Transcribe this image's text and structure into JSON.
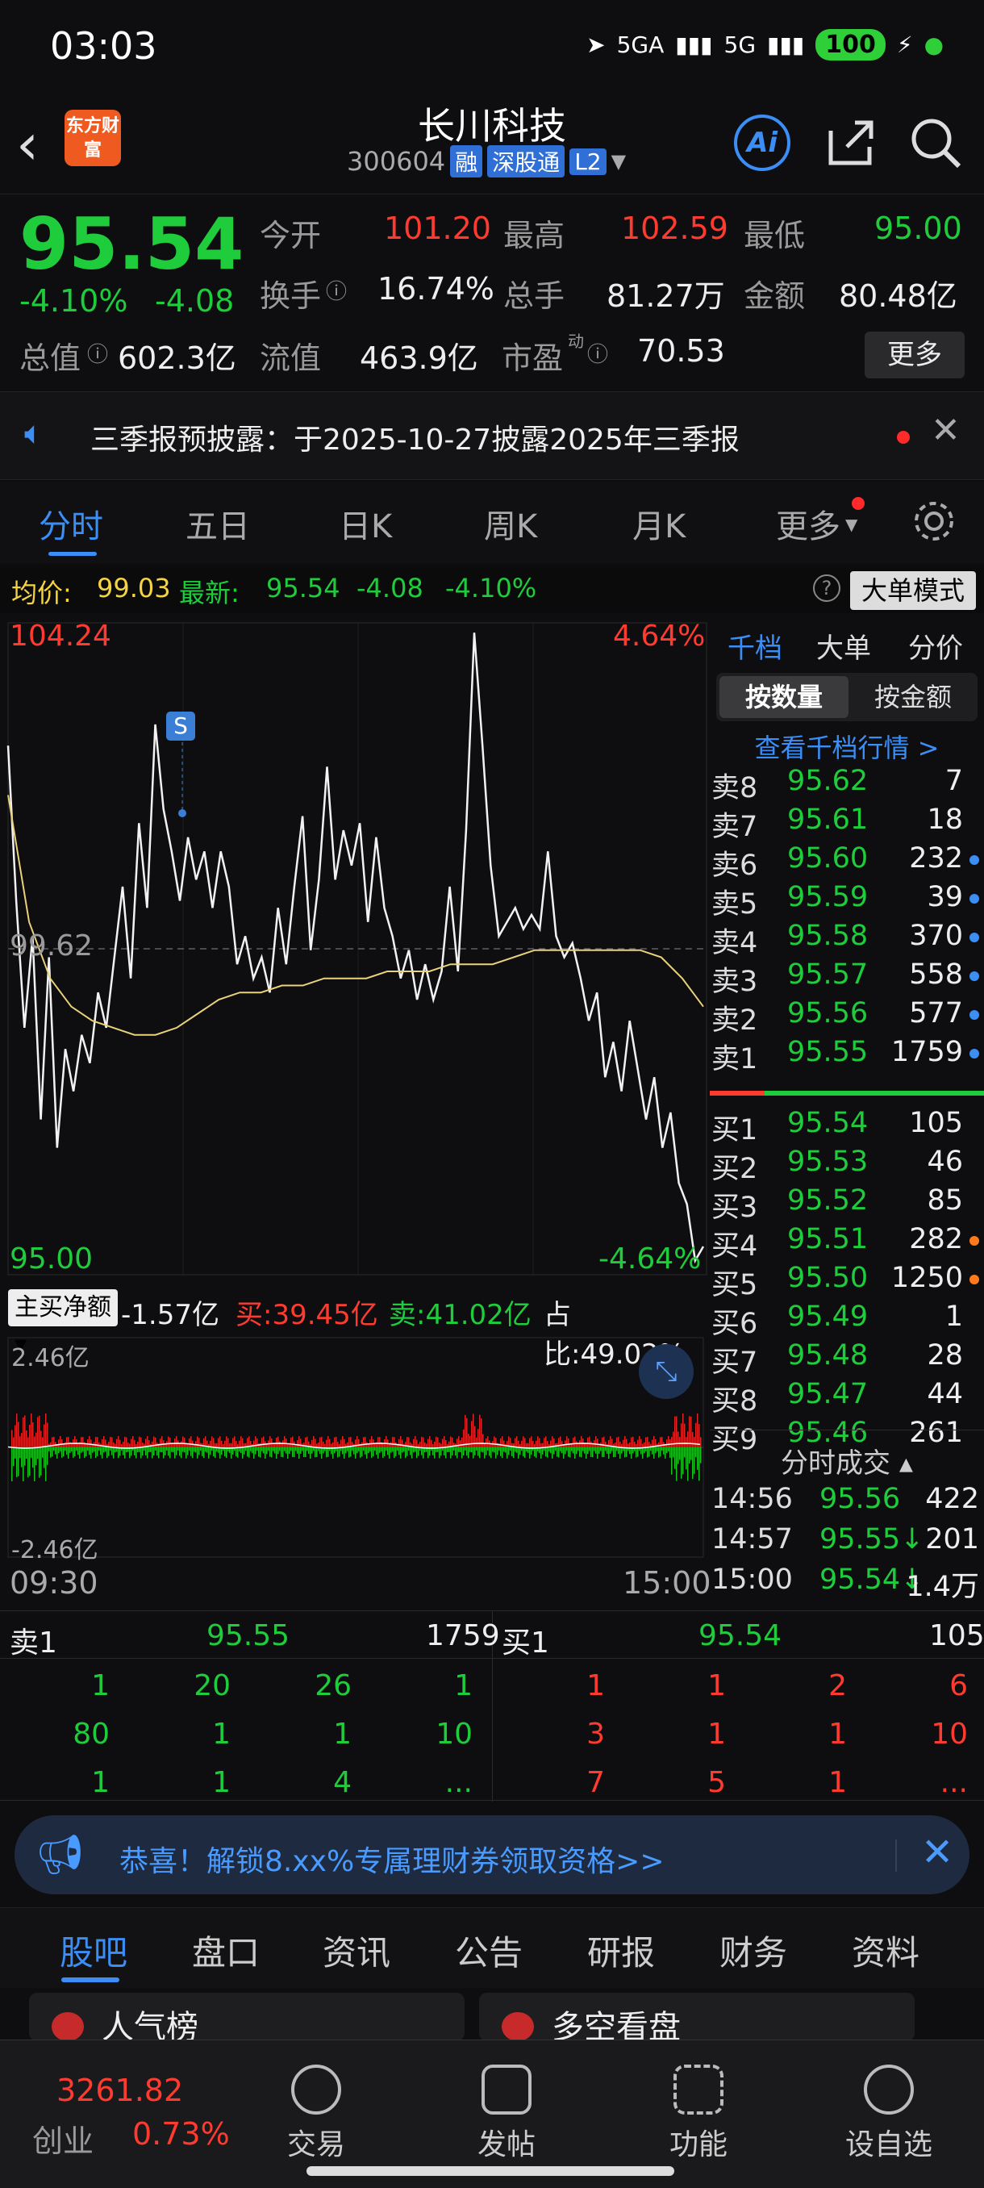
{
  "status": {
    "time": "03:03",
    "net1": "5GA",
    "net2": "5G",
    "battery": "100"
  },
  "header": {
    "title": "长川科技",
    "code": "300604",
    "tags": [
      "融",
      "深股通",
      "L2"
    ],
    "logo": "东方财富",
    "ai": "Ai"
  },
  "quote": {
    "price": "95.54",
    "change_pct": "-4.10%",
    "change": "-4.08",
    "open_label": "今开",
    "open": "101.20",
    "high_label": "最高",
    "high": "102.59",
    "low_label": "最低",
    "low": "95.00",
    "turnover_label": "换手",
    "turnover": "16.74%",
    "volume_label": "总手",
    "volume": "81.27万",
    "amount_label": "金额",
    "amount": "80.48亿",
    "mcap_label": "总值",
    "mcap": "602.3亿",
    "float_label": "流值",
    "float": "463.9亿",
    "pe_label": "市盈",
    "pe_sup": "动",
    "pe": "70.53",
    "more": "更多"
  },
  "notice": {
    "text": "三季报预披露：于2025-10-27披露2025年三季报"
  },
  "tabs": [
    "分时",
    "五日",
    "日K",
    "周K",
    "月K",
    "更多"
  ],
  "avgbar": {
    "avg_label": "均价:",
    "avg": "99.03",
    "latest_label": "最新:",
    "latest": "95.54",
    "chg": "-4.08",
    "pct": "-4.10%",
    "mode": "大单模式"
  },
  "chart_labels": {
    "top_price": "104.24",
    "top_pct": "4.64%",
    "mid_price": "99.62",
    "bottom_price": "95.00",
    "bottom_pct": "-4.64%",
    "marker": "S"
  },
  "chart_data": {
    "type": "line",
    "ylim": [
      95.0,
      104.24
    ],
    "series": [
      {
        "values": [
          102.5,
          100.3,
          98.5,
          99.8,
          97.2,
          99.5,
          96.8,
          98.2,
          97.6,
          98.4,
          98.0,
          99.0,
          98.5,
          99.5,
          100.5,
          99.2,
          101.4,
          100.2,
          102.8,
          101.6,
          101.0,
          100.3,
          101.2,
          100.6,
          101.0,
          100.2,
          101.0,
          100.5,
          99.4,
          99.8,
          99.2,
          99.5,
          99.0,
          100.2,
          99.4,
          100.5,
          101.5,
          99.6,
          100.6,
          102.2,
          100.6,
          101.3,
          100.8,
          101.4,
          100.0,
          101.2,
          100.2,
          99.8,
          99.2,
          99.6,
          98.9,
          99.4,
          98.9,
          99.3,
          100.5,
          99.3,
          101.3,
          104.1,
          102.5,
          100.8,
          99.8,
          100.0,
          100.2,
          99.9,
          100.1,
          99.9,
          101.0,
          99.8,
          99.5,
          99.7,
          99.2,
          98.6,
          99.0,
          97.8,
          98.3,
          97.6,
          98.6,
          97.9,
          97.2,
          97.8,
          96.8,
          97.3,
          96.3,
          96.0,
          95.2,
          95.4
        ],
        "note_avg": "avg"
      },
      {
        "values": [
          101.8,
          100.0,
          99.2,
          98.8,
          98.6,
          98.5,
          98.4,
          98.4,
          98.5,
          98.7,
          98.9,
          99.0,
          99.0,
          99.1,
          99.1,
          99.2,
          99.2,
          99.2,
          99.3,
          99.3,
          99.3,
          99.4,
          99.4,
          99.4,
          99.5,
          99.6,
          99.6,
          99.6,
          99.6,
          99.6,
          99.6,
          99.5,
          99.2,
          98.8
        ]
      }
    ]
  },
  "book": {
    "tabs": [
      "千档",
      "大单",
      "分价"
    ],
    "seg_on": "按数量",
    "seg_off": "按金额",
    "view": "查看千档行情 >",
    "asks": [
      {
        "label": "卖8",
        "price": "95.62",
        "vol": "7",
        "dot": ""
      },
      {
        "label": "卖7",
        "price": "95.61",
        "vol": "18",
        "dot": ""
      },
      {
        "label": "卖6",
        "price": "95.60",
        "vol": "232",
        "dot": "#3a8ef6"
      },
      {
        "label": "卖5",
        "price": "95.59",
        "vol": "39",
        "dot": "#3a8ef6"
      },
      {
        "label": "卖4",
        "price": "95.58",
        "vol": "370",
        "dot": "#3a8ef6"
      },
      {
        "label": "卖3",
        "price": "95.57",
        "vol": "558",
        "dot": "#3a8ef6"
      },
      {
        "label": "卖2",
        "price": "95.56",
        "vol": "577",
        "dot": "#3a8ef6"
      },
      {
        "label": "卖1",
        "price": "95.55",
        "vol": "1759",
        "dot": "#3a8ef6"
      }
    ],
    "bids": [
      {
        "label": "买1",
        "price": "95.54",
        "vol": "105",
        "dot": ""
      },
      {
        "label": "买2",
        "price": "95.53",
        "vol": "46",
        "dot": ""
      },
      {
        "label": "买3",
        "price": "95.52",
        "vol": "85",
        "dot": ""
      },
      {
        "label": "买4",
        "price": "95.51",
        "vol": "282",
        "dot": "#ff7a1a"
      },
      {
        "label": "买5",
        "price": "95.50",
        "vol": "1250",
        "dot": "#ff7a1a"
      },
      {
        "label": "买6",
        "price": "95.49",
        "vol": "1",
        "dot": ""
      },
      {
        "label": "买7",
        "price": "95.48",
        "vol": "28",
        "dot": ""
      },
      {
        "label": "买8",
        "price": "95.47",
        "vol": "44",
        "dot": ""
      },
      {
        "label": "买9",
        "price": "95.46",
        "vol": "261",
        "dot": ""
      }
    ],
    "trades_header": "分时成交",
    "trades": [
      {
        "time": "14:56",
        "price": "95.56",
        "vol": "422"
      },
      {
        "time": "14:57",
        "price": "95.55↓",
        "vol": "201"
      },
      {
        "time": "15:00",
        "price": "95.54↓",
        "vol": "1.4万"
      }
    ]
  },
  "flow": {
    "btn": "主买净额",
    "net": "-1.57亿",
    "buy": "买:39.45亿",
    "sell": "卖:41.02亿",
    "ratio": "占比:49.02%",
    "top": "2.46亿",
    "bottom": "-2.46亿",
    "t_start": "09:30",
    "t_end": "15:00"
  },
  "l2": {
    "sell_label": "卖1",
    "sell_price": "95.55",
    "sell_vol": "1759",
    "buy_label": "买1",
    "buy_price": "95.54",
    "buy_vol": "105",
    "sell_rows": [
      [
        "1",
        "20",
        "26",
        "1"
      ],
      [
        "80",
        "1",
        "1",
        "10"
      ],
      [
        "1",
        "1",
        "4",
        "..."
      ]
    ],
    "buy_rows": [
      [
        "1",
        "1",
        "2",
        "6"
      ],
      [
        "3",
        "1",
        "1",
        "10"
      ],
      [
        "7",
        "5",
        "1",
        "..."
      ]
    ]
  },
  "promo": {
    "text": "恭喜！解锁8.xx%专属理财券领取资格>>"
  },
  "bottom_tabs": [
    "股吧",
    "盘口",
    "资讯",
    "公告",
    "研报",
    "财务",
    "资料"
  ],
  "cards": [
    "人气榜",
    "多空看盘"
  ],
  "nav": {
    "index_value": "3261.82",
    "index_name": "创业",
    "index_pct": "0.73%",
    "items": [
      "交易",
      "发帖",
      "功能",
      "设自选"
    ]
  }
}
